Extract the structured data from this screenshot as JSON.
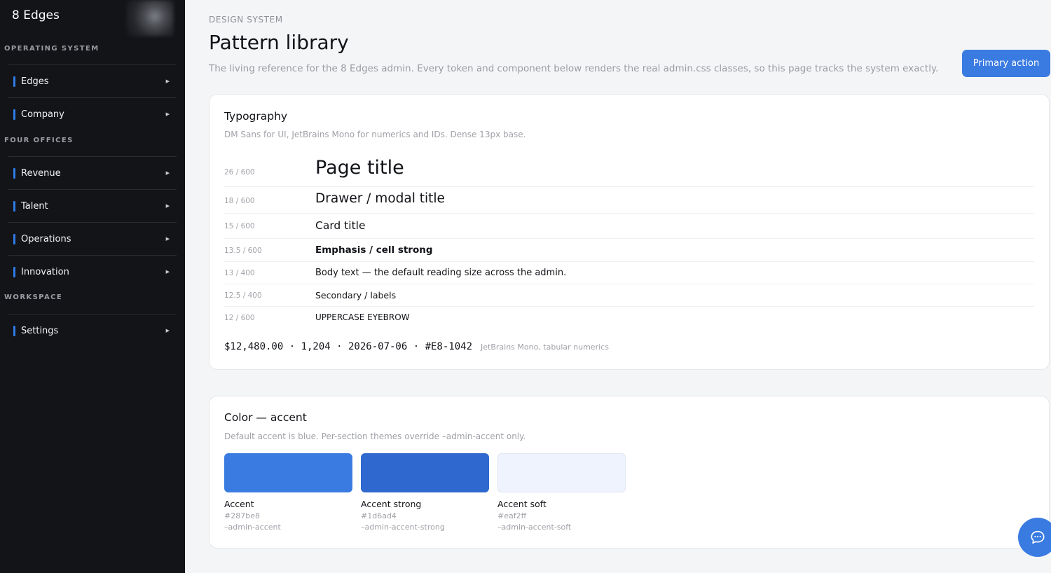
{
  "sidebar": {
    "brand": "8 Edges",
    "sections": [
      {
        "label": "OPERATING SYSTEM",
        "items": [
          {
            "label": "Edges"
          },
          {
            "label": "Company"
          }
        ]
      },
      {
        "label": "FOUR OFFICES",
        "items": [
          {
            "label": "Revenue"
          },
          {
            "label": "Talent"
          },
          {
            "label": "Operations"
          },
          {
            "label": "Innovation"
          }
        ]
      },
      {
        "label": "WORKSPACE",
        "items": [
          {
            "label": "Settings"
          }
        ]
      }
    ]
  },
  "header": {
    "eyebrow": "DESIGN SYSTEM",
    "title": "Pattern library",
    "subtitle": "The living reference for the 8 Edges admin. Every token and component below renders the real admin.css classes, so this page tracks the system exactly.",
    "primary_action": "Primary action"
  },
  "typography": {
    "title": "Typography",
    "subtitle": "DM Sans for UI, JetBrains Mono for numerics and IDs. Dense 13px base.",
    "rows": [
      {
        "meta": "26 / 600",
        "sample": "Page title"
      },
      {
        "meta": "18 / 600",
        "sample": "Drawer / modal title"
      },
      {
        "meta": "15 / 600",
        "sample": "Card title"
      },
      {
        "meta": "13.5 / 600",
        "sample": "Emphasis / cell strong"
      },
      {
        "meta": "13 / 400",
        "sample": "Body text — the default reading size across the admin."
      },
      {
        "meta": "12.5 / 400",
        "sample": "Secondary / labels"
      },
      {
        "meta": "12 / 600",
        "sample": "UPPERCASE EYEBROW"
      }
    ],
    "mono_sample": "$12,480.00 · 1,204 · 2026-07-06 · #E8-1042",
    "mono_note": "JetBrains Mono, tabular numerics"
  },
  "color_accent": {
    "title": "Color — accent",
    "subtitle": "Default accent is blue. Per-section themes override –admin-accent only.",
    "swatches": [
      {
        "name": "Accent",
        "hex": "#287be8",
        "var": "–admin-accent",
        "color": "#3a7be2"
      },
      {
        "name": "Accent strong",
        "hex": "#1d6ad4",
        "var": "–admin-accent-strong",
        "color": "#2f68cf"
      },
      {
        "name": "Accent soft",
        "hex": "#eaf2ff",
        "var": "–admin-accent-soft",
        "color": "#eef3fd"
      }
    ]
  },
  "icons": {
    "chat": "chat-bubble-icon",
    "chevron": "chevron-right-icon"
  }
}
